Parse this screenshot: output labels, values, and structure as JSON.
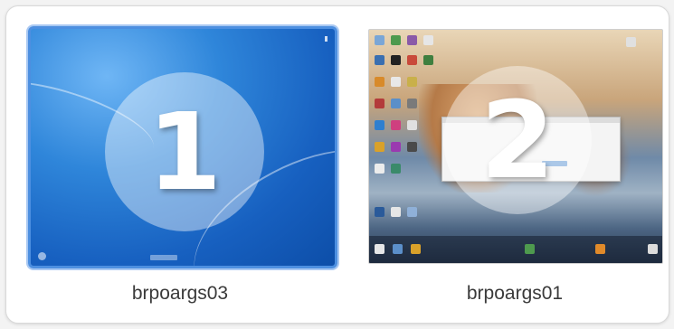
{
  "displays": [
    {
      "number": "1",
      "name": "brpoargs03",
      "selected": true
    },
    {
      "number": "2",
      "name": "brpoargs01",
      "selected": false
    }
  ],
  "colors": {
    "selection_border": "#4d8fe0",
    "label_text": "#3a3a3a"
  }
}
